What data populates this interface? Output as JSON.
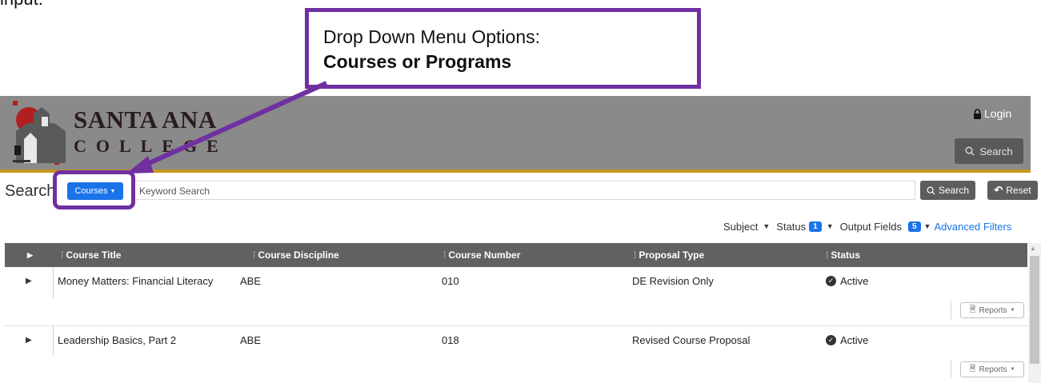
{
  "document": {
    "top_cut_text": "input.",
    "callout": {
      "line1": "Drop Down Menu Options:",
      "line2": "Courses or Programs"
    }
  },
  "header": {
    "logo_line1": "SANTA ANA",
    "logo_line2": "COLLEGE",
    "login_label": "Login",
    "search_label": "Search"
  },
  "search_bar": {
    "label": "Search",
    "type_button": "Courses",
    "placeholder": "Keyword Search",
    "search_button": "Search",
    "reset_button": "Reset"
  },
  "filters": {
    "subject": "Subject",
    "status": "Status",
    "status_count": "1",
    "output_fields": "Output Fields",
    "output_fields_count": "5",
    "advanced": "Advanced Filters"
  },
  "table": {
    "columns": [
      "Course Title",
      "Course Discipline",
      "Course Number",
      "Proposal Type",
      "Status"
    ],
    "rows": [
      {
        "title": "Money Matters: Financial Literacy",
        "discipline": "ABE",
        "number": "010",
        "proposal_type": "DE Revision Only",
        "status": "Active",
        "reports": "Reports"
      },
      {
        "title": "Leadership Basics, Part 2",
        "discipline": "ABE",
        "number": "018",
        "proposal_type": "Revised Course Proposal",
        "status": "Active",
        "reports": "Reports"
      }
    ]
  },
  "colors": {
    "accent": "#1a73e8",
    "annotation": "#7030a0",
    "header": "#8a8a8a",
    "header_stripe": "#c8961e"
  }
}
